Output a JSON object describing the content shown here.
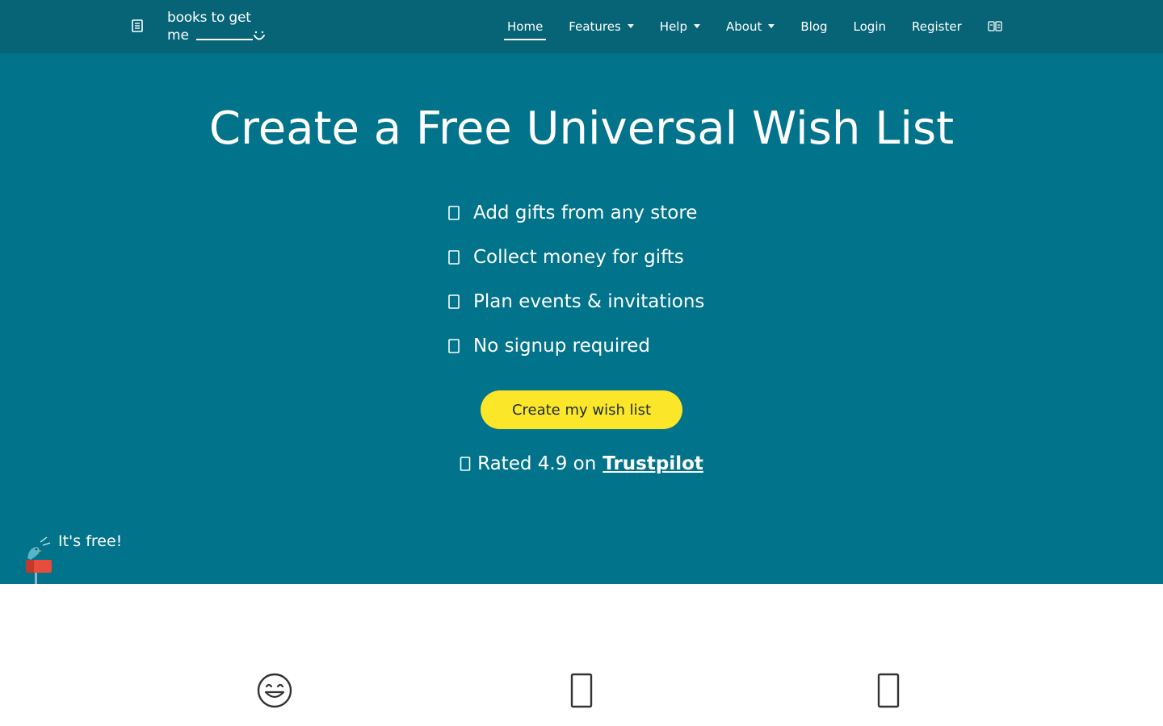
{
  "navbar": {
    "menu_icon": "list-icon",
    "brand": {
      "line1": "books to get",
      "line2": "me"
    },
    "items": [
      {
        "label": "Home",
        "active": true,
        "dropdown": false
      },
      {
        "label": "Features",
        "active": false,
        "dropdown": true
      },
      {
        "label": "Help",
        "active": false,
        "dropdown": true
      },
      {
        "label": "About",
        "active": false,
        "dropdown": true
      },
      {
        "label": "Blog",
        "active": false,
        "dropdown": false
      },
      {
        "label": "Login",
        "active": false,
        "dropdown": false
      },
      {
        "label": "Register",
        "active": false,
        "dropdown": false
      }
    ],
    "language_icon": "translate-icon"
  },
  "hero": {
    "title": "Create a Free Universal Wish List",
    "features": [
      {
        "icon": "gift-icon",
        "text": "Add gifts from any store"
      },
      {
        "icon": "money-icon",
        "text": "Collect money for gifts"
      },
      {
        "icon": "calendar-icon",
        "text": "Plan events & invitations"
      },
      {
        "icon": "check-icon",
        "text": "No signup required"
      }
    ],
    "cta_label": "Create my wish list",
    "rating": {
      "icon": "star-icon",
      "prefix": "Rated 4.9 on",
      "link": "Trustpilot"
    },
    "free_badge": "It's free!"
  },
  "lower": {
    "icons": [
      "smile-icon",
      "list-icon",
      "phone-icon"
    ]
  },
  "colors": {
    "navbar_bg": "#066476",
    "hero_bg": "#01738b",
    "cta_bg": "#fbe62a",
    "text_light": "#ffffff"
  }
}
